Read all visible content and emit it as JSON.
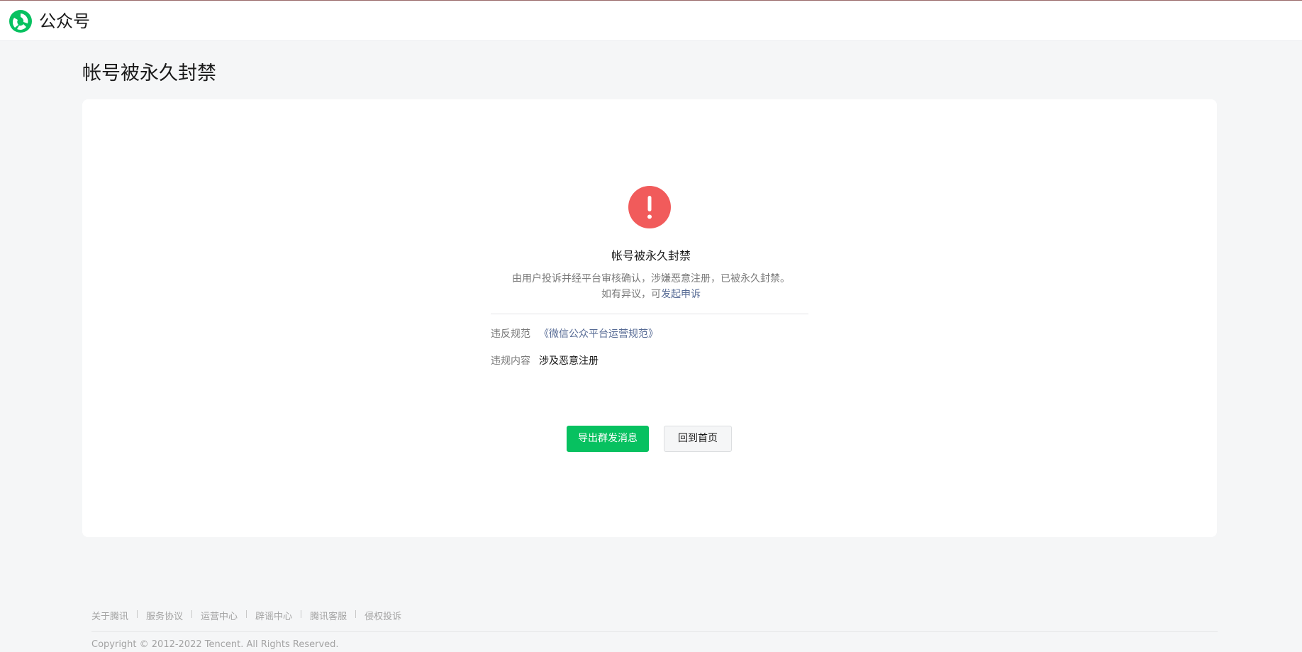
{
  "header": {
    "brand": "公众号",
    "logo_icon": "wechat-official-account-logo-icon",
    "accent_color": "#07c160"
  },
  "page": {
    "title": "帐号被永久封禁"
  },
  "status": {
    "icon": "exclamation-icon",
    "icon_color": "#f15b5b",
    "title": "帐号被永久封禁",
    "line1": "由用户投诉并经平台审核确认，涉嫌恶意注册，已被永久封禁。",
    "line2_prefix": "如有异议，可",
    "appeal_link": "发起申诉"
  },
  "details": {
    "rule_label": "违反规范",
    "rule_link": "《微信公众平台运营规范》",
    "content_label": "违规内容",
    "content_value": "涉及恶意注册"
  },
  "actions": {
    "export_label": "导出群发消息",
    "home_label": "回到首页"
  },
  "footer": {
    "links": [
      "关于腾讯",
      "服务协议",
      "运营中心",
      "辟谣中心",
      "腾讯客服",
      "侵权投诉"
    ],
    "copyright": "Copyright © 2012-2022 Tencent. All Rights Reserved."
  }
}
